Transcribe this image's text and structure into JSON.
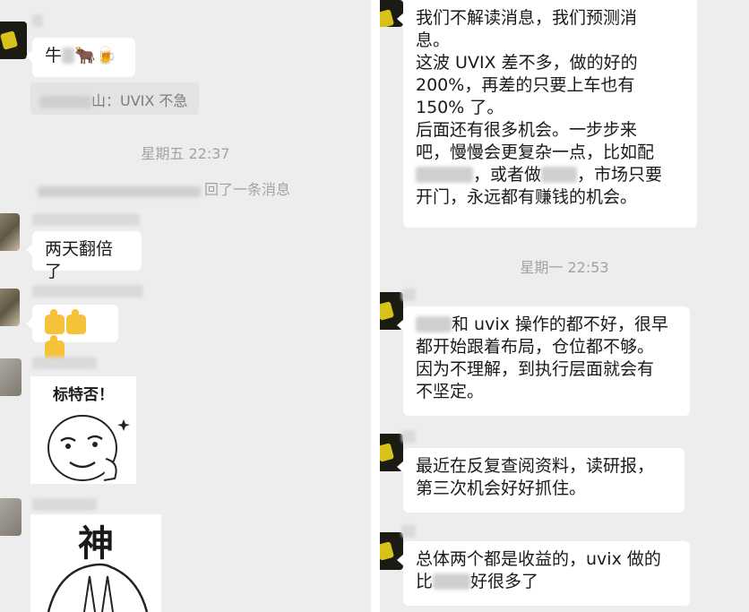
{
  "left": {
    "msg1": {
      "prefix": "牛",
      "emoji": "🐂🍺"
    },
    "quote": {
      "suffix": "山：UVIX 不急"
    },
    "time1": "星期五 22:37",
    "recall": {
      "suffix": "回了一条消息"
    },
    "msg2": "两天翻倍了",
    "thumbs": "👍👍👍",
    "sticker1": {
      "caption": "标特否！"
    },
    "sticker2": {
      "char": "神"
    }
  },
  "right": {
    "msg_top": {
      "l1": "我们不解读消息，我们预测消",
      "l2": "息。",
      "l3": "这波 UVIX 差不多，做的好的",
      "l4": "200%，再差的只要上车也有",
      "l5": "150% 了。",
      "l6": "后面还有很多机会。一步步来",
      "l7": "吧，慢慢会更复杂一点，比如配",
      "l8a": "，或者做",
      "l8b": "，市场只要",
      "l9": "开门，永远都有赚钱的机会。"
    },
    "time2": "星期一 22:53",
    "msg_b": {
      "l1b": "和 uvix 操作的都不好，很早",
      "l2": "都开始跟着布局，仓位都不够。",
      "l3": "因为不理解，到执行层面就会有",
      "l4": "不坚定。"
    },
    "msg_c": {
      "l1": "最近在反复查阅资料，读研报，",
      "l2": "第三次机会好好抓住。"
    },
    "msg_d": {
      "l1": "总体两个都是收益的，uvix 做的",
      "l2a": "比",
      "l2b": "好很多了"
    }
  }
}
